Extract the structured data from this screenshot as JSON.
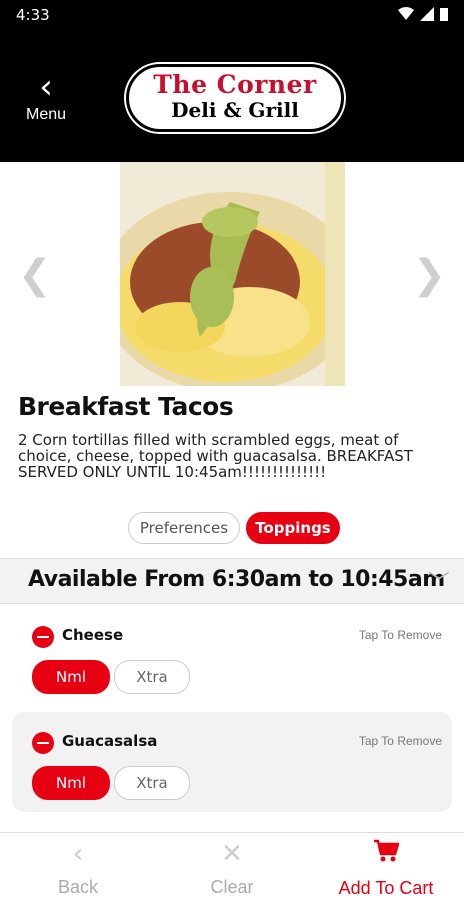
{
  "status": {
    "time": "4:33"
  },
  "header": {
    "menu_label": "Menu",
    "logo_line1": "The Corner",
    "logo_line2": "Deli & Grill"
  },
  "item": {
    "title": "Breakfast Tacos",
    "description": "2 Corn tortillas filled with scrambled eggs, meat of choice, cheese, topped with guacasalsa. BREAKFAST SERVED ONLY UNTIL 10:45am!!!!!!!!!!!!!!"
  },
  "tabs": {
    "preferences": "Preferences",
    "toppings": "Toppings"
  },
  "availability": "Available From 6:30am to 10:45am",
  "toppings": [
    {
      "name": "Cheese",
      "action": "Tap To Remove",
      "options": [
        "Nml",
        "Xtra"
      ],
      "selected": "Nml"
    },
    {
      "name": "Guacasalsa",
      "action": "Tap To Remove",
      "options": [
        "Nml",
        "Xtra"
      ],
      "selected": "Nml"
    }
  ],
  "bottom": {
    "back": "Back",
    "clear": "Clear",
    "add_to_cart": "Add To Cart"
  },
  "colors": {
    "accent": "#e60012",
    "header_bg": "#000000"
  }
}
